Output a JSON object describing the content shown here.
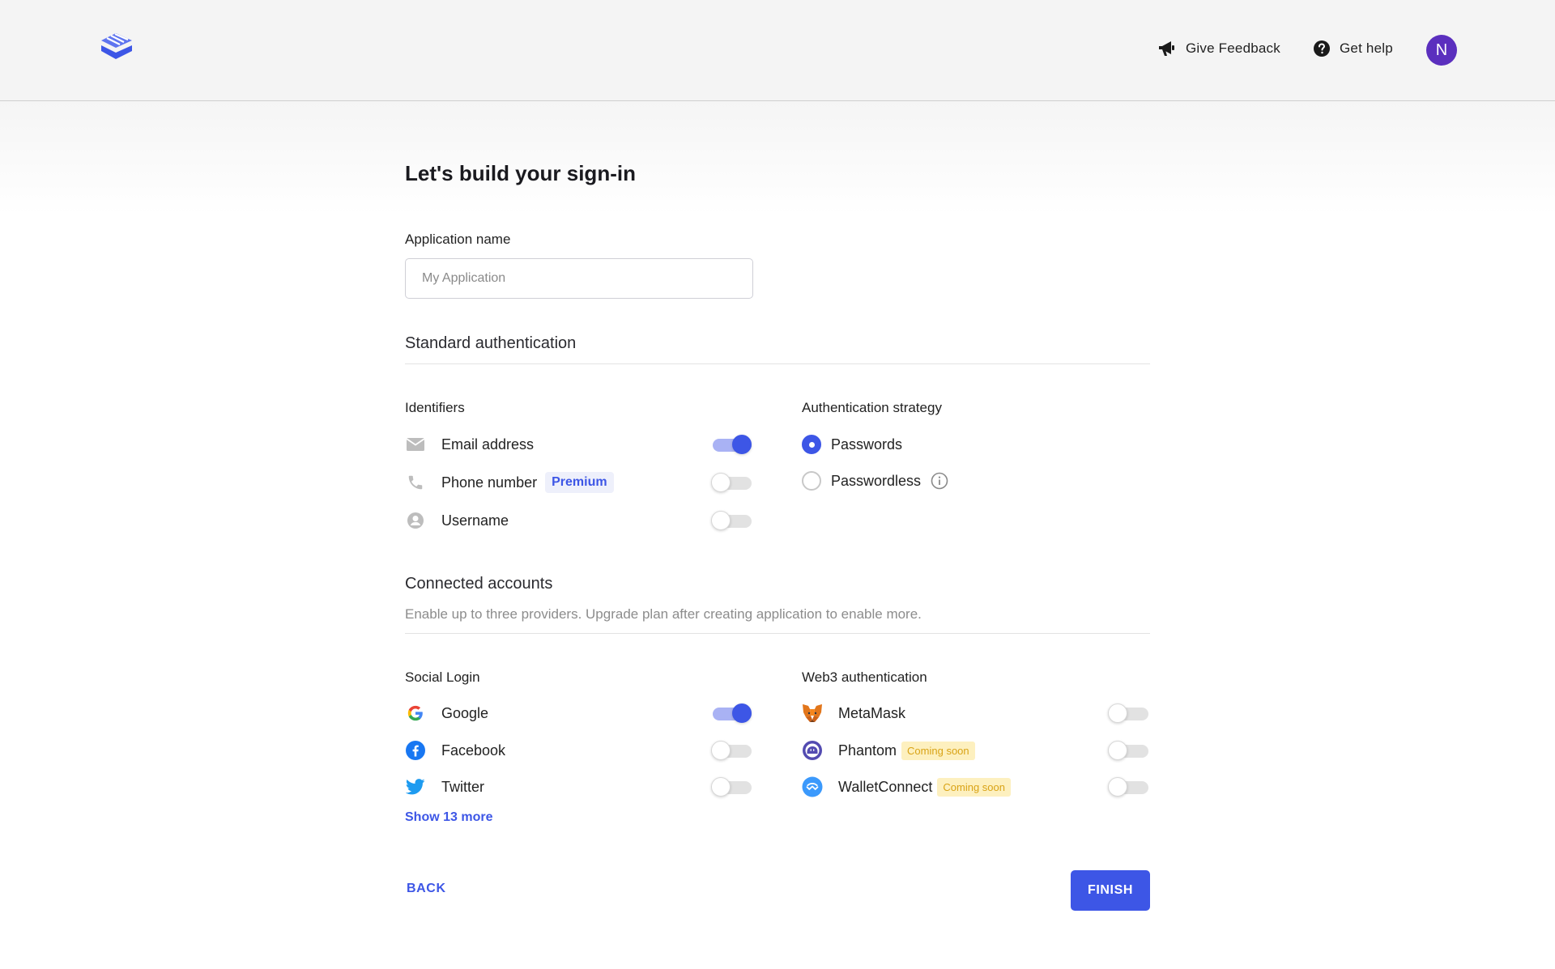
{
  "header": {
    "feedback_label": "Give Feedback",
    "help_label": "Get help",
    "avatar_initial": "N"
  },
  "page": {
    "title": "Let's build your sign-in",
    "app_name_label": "Application name",
    "app_name_placeholder": "My Application",
    "app_name_value": ""
  },
  "standard_auth": {
    "title": "Standard authentication",
    "identifiers": {
      "title": "Identifiers",
      "items": [
        {
          "label": "Email address",
          "icon": "mail-icon",
          "enabled": true
        },
        {
          "label": "Phone number",
          "icon": "phone-icon",
          "badge": "Premium",
          "enabled": false
        },
        {
          "label": "Username",
          "icon": "user-circle-icon",
          "enabled": false
        }
      ]
    },
    "strategy": {
      "title": "Authentication strategy",
      "options": [
        {
          "label": "Passwords",
          "selected": true
        },
        {
          "label": "Passwordless",
          "selected": false,
          "icon": "info-icon"
        }
      ]
    }
  },
  "connected_accounts": {
    "title": "Connected accounts",
    "subtitle": "Enable up to three providers. Upgrade plan after creating application to enable more.",
    "social": {
      "title": "Social Login",
      "items": [
        {
          "label": "Google",
          "icon": "google-icon",
          "enabled": true
        },
        {
          "label": "Facebook",
          "icon": "facebook-icon",
          "enabled": false
        },
        {
          "label": "Twitter",
          "icon": "twitter-icon",
          "enabled": false
        }
      ],
      "show_more": "Show 13 more"
    },
    "web3": {
      "title": "Web3 authentication",
      "items": [
        {
          "label": "MetaMask",
          "icon": "metamask-icon",
          "enabled": false
        },
        {
          "label": "Phantom",
          "icon": "phantom-icon",
          "badge": "Coming soon",
          "enabled": false
        },
        {
          "label": "WalletConnect",
          "icon": "walletconnect-icon",
          "badge": "Coming soon",
          "enabled": false
        }
      ]
    }
  },
  "actions": {
    "back_label": "BACK",
    "finish_label": "FINISH"
  },
  "colors": {
    "accent": "#3d56e6",
    "avatar_bg": "#5b2fbe",
    "premium_badge_bg": "#eef0fb",
    "coming_soon_bg": "#fdf0bf",
    "coming_soon_text": "#d9a316"
  }
}
